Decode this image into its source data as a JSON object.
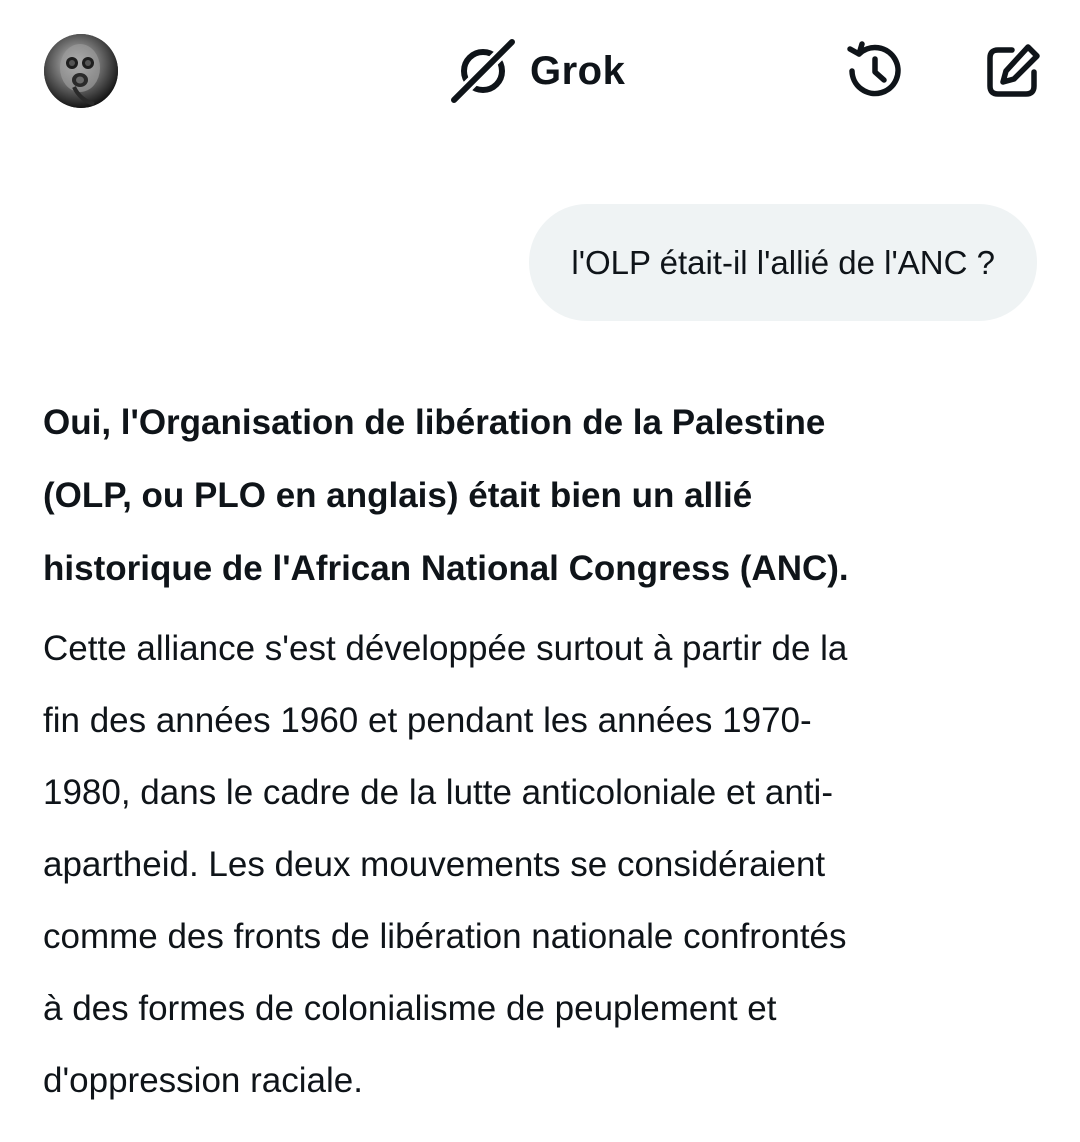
{
  "header": {
    "title": "Grok",
    "avatar_icon": "gas-mask-avatar",
    "logo_icon": "grok-logo-icon",
    "history_icon": "history-clock-icon",
    "new_chat_icon": "edit-square-icon"
  },
  "conversation": {
    "user_message": "l'OLP était-il l'allié de l'ANC ?",
    "reply": {
      "bold_lines": [
        "Oui, l'Organisation de libération de la Palestine",
        "(OLP, ou PLO en anglais) était bien un allié",
        "historique de l'African National Congress (ANC)."
      ],
      "body_lines": [
        "Cette alliance s'est développée surtout à partir de la",
        "fin des années 1960 et pendant les années 1970-",
        "1980, dans le cadre de la lutte anticoloniale et anti-",
        "apartheid. Les deux mouvements se considéraient",
        "comme des fronts de libération nationale confrontés",
        "à des formes de colonialisme de peuplement et",
        "d'oppression raciale."
      ]
    }
  },
  "colors": {
    "text": "#0f1419",
    "bubble_bg": "#eff3f4",
    "background": "#ffffff"
  }
}
